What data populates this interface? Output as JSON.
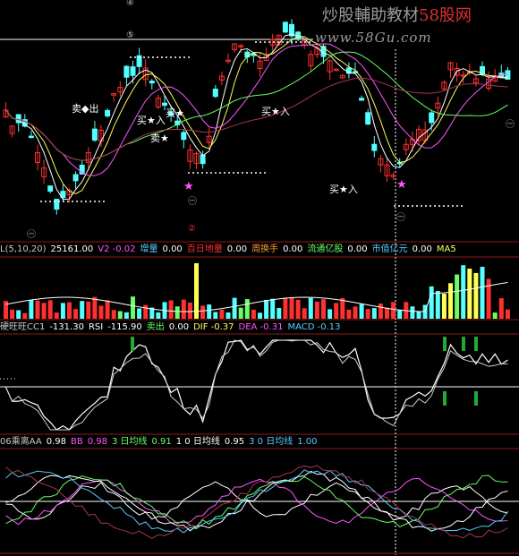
{
  "watermark": {
    "text_main": "炒股輔助教材",
    "text_brand": "58股网",
    "url": "www.58Gu.com"
  },
  "price_panel": {
    "signals": [
      {
        "label": "卖◆出",
        "color": "#ffffff"
      },
      {
        "label": "买★入",
        "color": "#ffffff"
      },
      {
        "label": "卖★",
        "color": "#ffffff"
      },
      {
        "label": "买★",
        "color": "#ffffff"
      },
      {
        "label": "买★入",
        "color": "#ffffff"
      },
      {
        "label": "买★入",
        "color": "#ffffff"
      }
    ],
    "markers": [
      "④",
      "⑤",
      "㊀",
      "②",
      "㊀",
      "㊀",
      "㊀"
    ]
  },
  "volume_header": [
    {
      "text": "L(5,10,20)",
      "color": "#c8c8c8"
    },
    {
      "text": "25161.00",
      "color": "#ffffff"
    },
    {
      "text": "V2 -0.02",
      "color": "#ff55ff"
    },
    {
      "text": "增量",
      "color": "#55ccff"
    },
    {
      "text": "0.00",
      "color": "#ffffff"
    },
    {
      "text": "百日地量",
      "color": "#ff3030"
    },
    {
      "text": "0.00",
      "color": "#ffffff"
    },
    {
      "text": "周换手",
      "color": "#ff9933"
    },
    {
      "text": "0.00",
      "color": "#ffffff"
    },
    {
      "text": "流通亿股",
      "color": "#66ff66"
    },
    {
      "text": "0.00",
      "color": "#ffffff"
    },
    {
      "text": "市值亿元",
      "color": "#55ccff"
    },
    {
      "text": "0.00",
      "color": "#ffffff"
    },
    {
      "text": "MA5",
      "color": "#ffff55"
    }
  ],
  "indicator_header": [
    {
      "text": "硬旺旺CC1",
      "color": "#c8c8c8"
    },
    {
      "text": "-131.30",
      "color": "#ffffff"
    },
    {
      "text": "RSI",
      "color": "#ffffff"
    },
    {
      "text": "-115.90",
      "color": "#ffffff"
    },
    {
      "text": "卖出",
      "color": "#66ff66"
    },
    {
      "text": "0.00",
      "color": "#ffffff"
    },
    {
      "text": "DIF -0.37",
      "color": "#ffff55"
    },
    {
      "text": "DEA -0.31",
      "color": "#ff55ff"
    },
    {
      "text": "MACD -0.13",
      "color": "#55ccff"
    }
  ],
  "ma_header": [
    {
      "text": "06乘离AA",
      "color": "#c8c8c8"
    },
    {
      "text": "0.98",
      "color": "#ffffff"
    },
    {
      "text": "BB",
      "color": "#ff55ff"
    },
    {
      "text": "0.98",
      "color": "#ff55ff"
    },
    {
      "text": "3 日均线",
      "color": "#66ff66"
    },
    {
      "text": "0.91",
      "color": "#66ff66"
    },
    {
      "text": "1 0 日均线",
      "color": "#ffffff"
    },
    {
      "text": "0.95",
      "color": "#ffffff"
    },
    {
      "text": "3 0 日均线",
      "color": "#55ccff"
    },
    {
      "text": "1.00",
      "color": "#55ccff"
    }
  ],
  "colors": {
    "up": "#ff3030",
    "down": "#55ffff",
    "frame": "#8b1a1a",
    "volume_yellow": "#ffff55"
  }
}
